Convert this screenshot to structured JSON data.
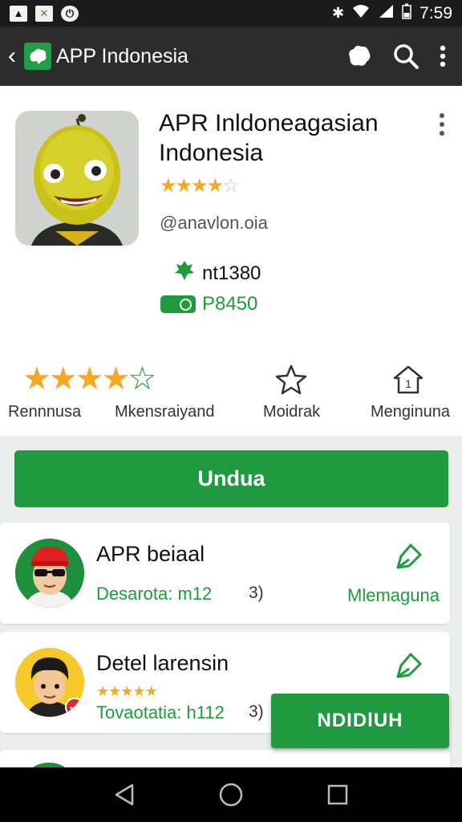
{
  "status_bar": {
    "time": "7:59",
    "left_icons": [
      "image-icon",
      "x-icon",
      "power-icon"
    ],
    "right_icons": [
      "bluetooth-icon",
      "wifi-icon",
      "signal-icon",
      "battery-icon"
    ]
  },
  "app_bar": {
    "title": "APP Indonesia",
    "actions": [
      "puzzle-icon",
      "search-icon",
      "more-vert-icon"
    ]
  },
  "app": {
    "title": "APR Inldoneagasian Indonesia",
    "rating_stars": 4,
    "rating_max": 5,
    "handle": "@anavlon.oia",
    "downloads": "nt1380",
    "size": "P8450"
  },
  "metrics": [
    {
      "label": "Rennnusa",
      "icon": "stars-rating-icon"
    },
    {
      "label": "Mkensraiyand",
      "icon": "star-outline-icon"
    },
    {
      "label": "Moidrak",
      "icon": "star-outline-icon"
    },
    {
      "label": "Menginuna",
      "icon": "home-icon"
    }
  ],
  "metric_star_rating": 4,
  "download_button": "Undua",
  "list": [
    {
      "title": "APR beiaal",
      "subtitle": "Desarota: m12",
      "number": "3)",
      "action_label": "Mlemaguna"
    },
    {
      "title": "Detel larensin",
      "subtitle": "Tovaotatia: h112",
      "number": "3)",
      "mini_stars": 5,
      "action_label": ""
    }
  ],
  "floating_button": "NDIDlUH",
  "colors": {
    "accent_green": "#1f9a3e",
    "star_orange": "#f7a823",
    "app_bar_bg": "#2c2c2c",
    "status_bar_bg": "#1b1b1b"
  }
}
